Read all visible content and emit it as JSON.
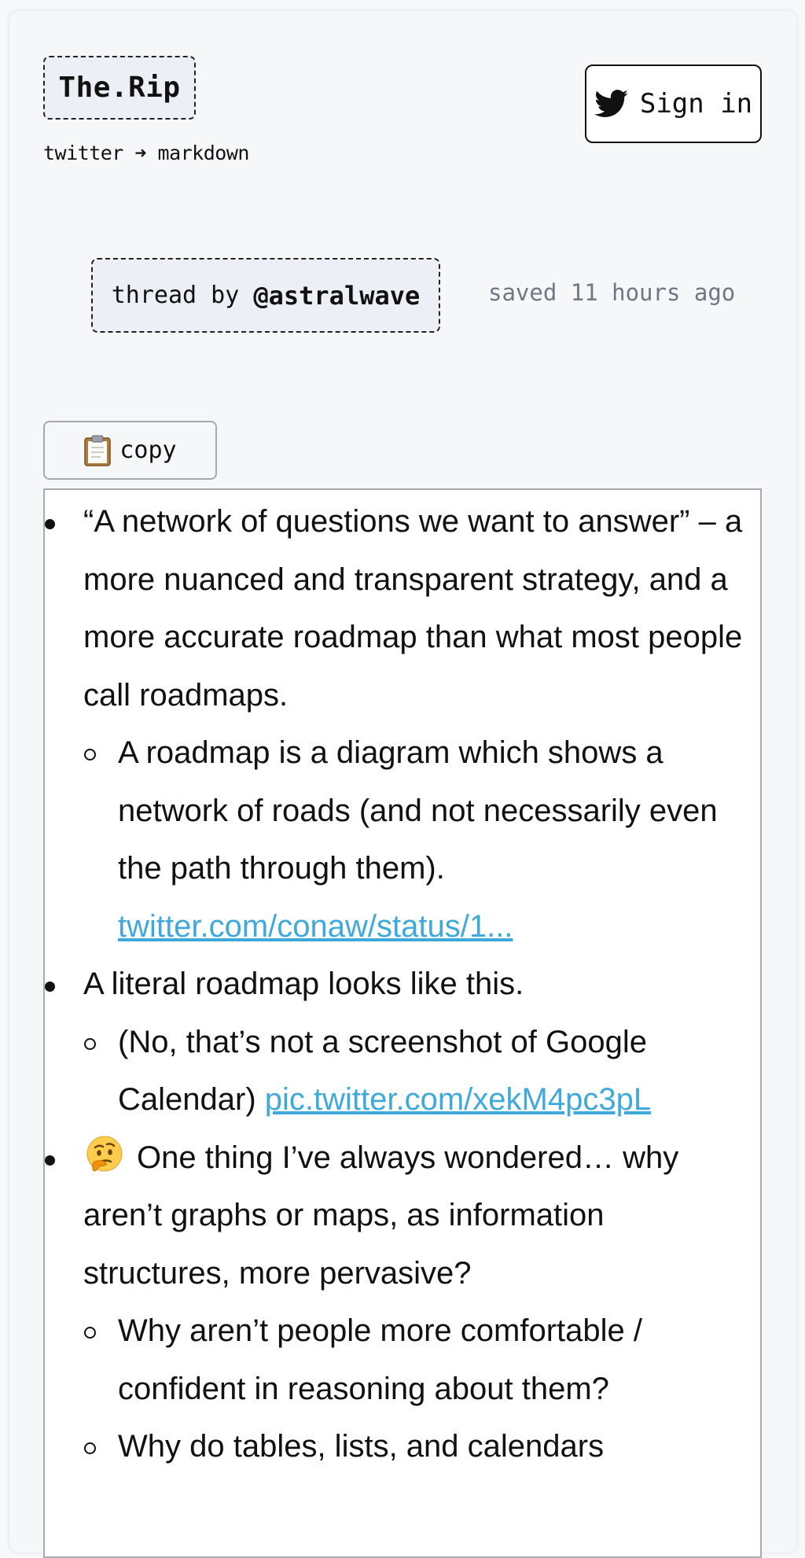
{
  "header": {
    "logo": "The.Rip",
    "tagline": "twitter ➜ markdown",
    "signin_label": "Sign in",
    "bird_icon": "twitter-bird-icon"
  },
  "thread": {
    "prefix": "thread by ",
    "handle": "@astralwave",
    "saved": "saved 11 hours ago"
  },
  "copy": {
    "label": "copy",
    "icon": "clipboard-icon"
  },
  "items": [
    {
      "text": "“A network of questions we want to answer” – a more nuanced and transparent strategy, and a more accurate roadmap than what most people call roadmaps.",
      "children": [
        {
          "text": "A roadmap is a diagram which shows a network of roads (and not necessarily even the path through them). ",
          "link": "twitter.com/conaw/status/1..."
        }
      ]
    },
    {
      "text": "A literal roadmap looks like this.",
      "children": [
        {
          "text": "(No, that’s not a screenshot of Google Calendar) ",
          "link": "pic.twitter.com/xekM4pc3pL"
        }
      ]
    },
    {
      "emoji": "thinking-face-icon",
      "text": "One thing I’ve always wondered… why aren’t graphs or maps, as information structures, more pervasive?",
      "children": [
        {
          "text": "Why aren’t people more comfortable / confident in reasoning about them?"
        },
        {
          "text": "Why do tables, lists, and calendars"
        }
      ]
    }
  ],
  "colors": {
    "link": "#3fa9db",
    "muted": "#6f7782",
    "tag_bg": "#eceff5"
  }
}
